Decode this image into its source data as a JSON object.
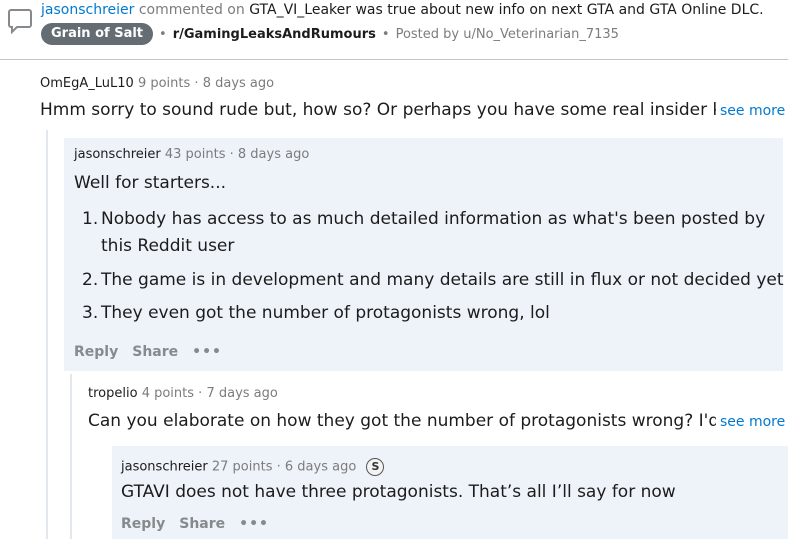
{
  "header": {
    "user": "jasonschreier",
    "action": "commented on",
    "post_title": "GTA_VI_Leaker was true about new info on next GTA and GTA Online DLC.",
    "flair": "Grain of Salt",
    "subreddit": "r/GamingLeaksAndRumours",
    "posted_by": "Posted by u/No_Veterinarian_7135"
  },
  "comments": [
    {
      "author": "OmEgA_LuL10",
      "points": "9 points",
      "time": "8 days ago",
      "body": "Hmm sorry to sound rude but, how so? Or perhaps you have some real insider kn",
      "see_more": "see more"
    },
    {
      "author": "jasonschreier",
      "points": "43 points",
      "time": "8 days ago",
      "body": "Well for starters...",
      "list": [
        "Nobody has access to as much detailed information as what's been posted by",
        "this Reddit user",
        "The game is in development and many details are still in flux or not decided yet",
        "They even got the number of protagonists wrong, lol"
      ],
      "actions": {
        "reply": "Reply",
        "share": "Share",
        "more": "•••"
      }
    },
    {
      "author": "tropelio",
      "points": "4 points",
      "time": "7 days ago",
      "body": "Can you elaborate on how they got the number of protagonists wrong? I'd b",
      "see_more": "see more"
    },
    {
      "author": "jasonschreier",
      "points": "27 points",
      "time": "6 days ago",
      "award": "S",
      "body": "GTAVI does not have three protagonists. That’s all I’ll say for now",
      "actions": {
        "reply": "Reply",
        "share": "Share",
        "more": "•••"
      }
    }
  ],
  "separator": "·",
  "bullet": "•"
}
